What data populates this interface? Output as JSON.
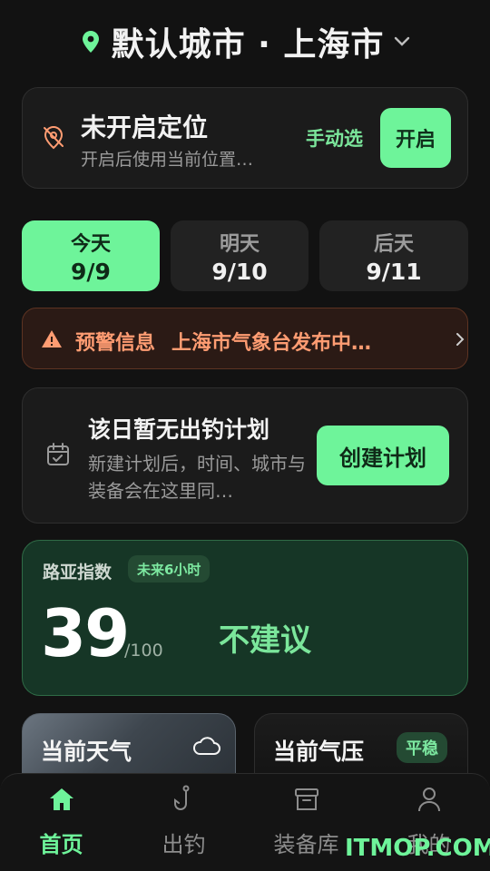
{
  "header": {
    "title": "默认城市 · 上海市",
    "pin_icon": "location-pin-icon",
    "chevron_icon": "chevron-down-icon"
  },
  "location_card": {
    "title": "未开启定位",
    "subtitle": "开启后使用当前位置…",
    "manual_label": "手动选",
    "enable_label": "开启",
    "icon": "location-off-icon"
  },
  "day_tabs": [
    {
      "label": "今天",
      "date": "9/9",
      "active": true
    },
    {
      "label": "明天",
      "date": "9/10",
      "active": false
    },
    {
      "label": "后天",
      "date": "9/11",
      "active": false
    }
  ],
  "warning": {
    "label": "预警信息",
    "text": "上海市气象台发布中…",
    "icon": "warning-icon"
  },
  "plan_card": {
    "title": "该日暂无出钓计划",
    "description": "新建计划后，时间、城市与装备会在这里同…",
    "button_label": "创建计划",
    "icon": "calendar-check-icon"
  },
  "lure_index": {
    "title": "路亚指数",
    "badge": "未来6小时",
    "score": "39",
    "max": "/100",
    "verdict": "不建议"
  },
  "mini_cards": {
    "weather": {
      "title": "当前天气",
      "icon": "cloud-icon"
    },
    "pressure": {
      "title": "当前气压",
      "badge": "平稳"
    }
  },
  "tabbar": [
    {
      "label": "首页",
      "icon": "home-icon",
      "active": true
    },
    {
      "label": "出钓",
      "icon": "fishing-hook-icon",
      "active": false
    },
    {
      "label": "装备库",
      "icon": "archive-box-icon",
      "active": false
    },
    {
      "label": "我的",
      "icon": "user-icon",
      "active": false
    }
  ],
  "watermark": "ITMOP.COM",
  "colors": {
    "accent": "#6ef49a",
    "background": "#121212",
    "card": "#1b1b1b",
    "warning": "#ff9c72",
    "lure_card_bg": "#163626"
  }
}
